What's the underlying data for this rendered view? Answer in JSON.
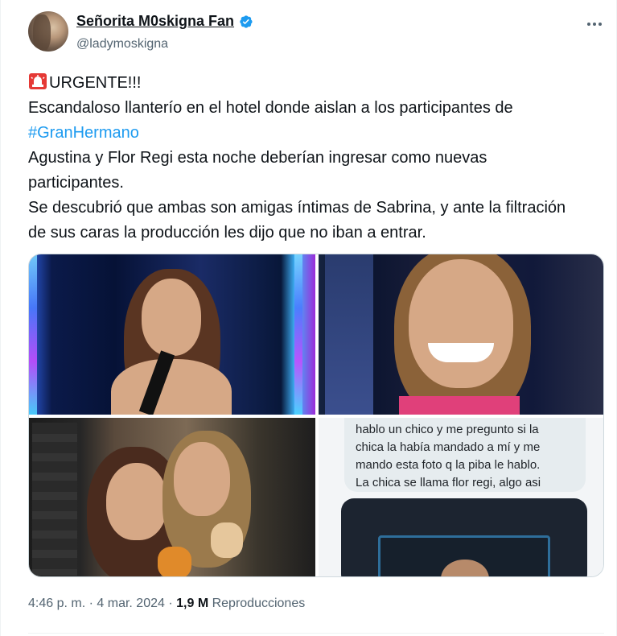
{
  "author": {
    "display_name": "Señorita M0skigna Fan",
    "handle": "@ladymoskigna",
    "verified": true
  },
  "tweet": {
    "lines": [
      {
        "prefix_icon": "siren-icon",
        "text": "URGENTE!!!"
      },
      {
        "text": "Escandaloso llanterío en el hotel donde aislan a los participantes de"
      },
      {
        "hashtag": "#GranHermano"
      },
      {
        "text": "Agustina y Flor Regi esta noche deberían ingresar como nuevas"
      },
      {
        "text": "participantes."
      },
      {
        "text": "Se descubrió que ambas son amigas íntimas de Sabrina, y ante la filtración"
      },
      {
        "text": "de sus caras la producción les dijo que no iban a entrar."
      }
    ]
  },
  "media": {
    "count": 4,
    "chat_lines": [
      "hablo un chico y me pregunto si la",
      "chica la había mandado a mí y me",
      "mando esta foto q la piba le hablo.",
      "La chica se llama flor regi, algo asi"
    ]
  },
  "meta": {
    "time": "4:46 p. m.",
    "separator": "·",
    "date": "4 mar. 2024",
    "views_count": "1,9 M",
    "views_label": "Reproducciones"
  },
  "colors": {
    "accent": "#1d9bf0",
    "text_primary": "#0f1419",
    "text_secondary": "#536471",
    "siren": "#e53935"
  }
}
